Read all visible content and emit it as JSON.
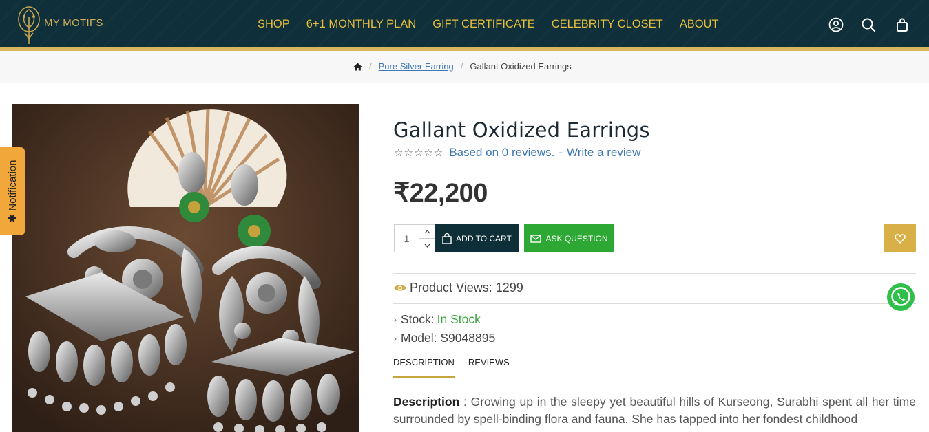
{
  "header": {
    "logo_text": "MY MOTIFS",
    "nav": [
      "SHOP",
      "6+1 MONTHLY PLAN",
      "GIFT CERTIFICATE",
      "CELEBRITY CLOSET",
      "ABOUT"
    ],
    "icons": [
      "account-icon",
      "search-icon",
      "cart-icon"
    ],
    "colors": {
      "background": "#0f2f3a",
      "accent_bar": "#d8b45a",
      "nav_text": "#e6bd3a"
    }
  },
  "breadcrumb": {
    "home_icon": "home-icon",
    "category": "Pure Silver Earring",
    "current": "Gallant Oxidized Earrings"
  },
  "notification_tab": {
    "label": "Notification"
  },
  "product": {
    "title": "Gallant Oxidized Earrings",
    "rating_stars": "☆☆☆☆☆",
    "rating": 0,
    "reviews_text": "Based on 0 reviews.",
    "review_separator": "-",
    "write_review": "Write a review",
    "price": "₹22,200",
    "quantity": "1",
    "add_to_cart": "ADD TO CART",
    "ask_question": "ASK QUESTION",
    "views_label": "Product Views: 1299",
    "stock_label": "Stock:",
    "stock_value": "In Stock",
    "model_label": "Model: S9048895"
  },
  "tabs": [
    "DESCRIPTION",
    "REVIEWS"
  ],
  "description": {
    "heading": "Description",
    "text": " : Growing up in the sleepy yet beautiful hills of Kurseong, Surabhi spent all her time surrounded by spell-binding flora and fauna. She has tapped into her fondest childhood"
  },
  "colors": {
    "add_to_cart_bg": "#0e2f38",
    "ask_question_bg": "#2ea834",
    "wishlist_bg": "#d8b047",
    "in_stock": "#3aa53f",
    "link": "#3d78b5"
  }
}
